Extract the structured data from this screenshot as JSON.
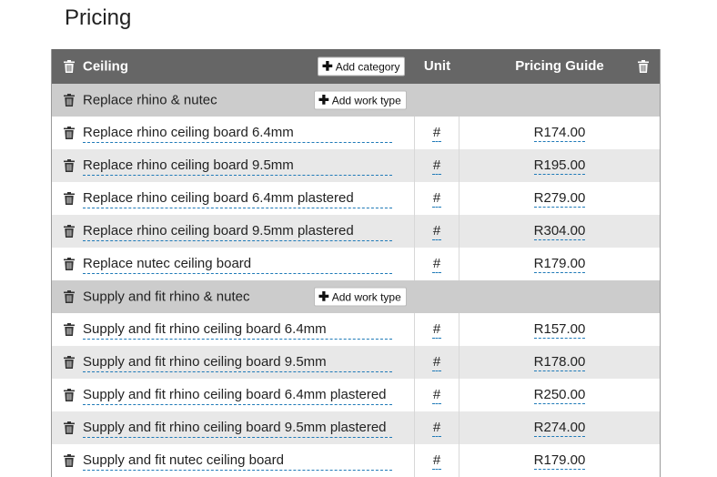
{
  "page": {
    "title": "Pricing"
  },
  "header": {
    "category": "Ceiling",
    "add_category_label": "Add category",
    "unit_label": "Unit",
    "pricing_guide_label": "Pricing Guide"
  },
  "groups": [
    {
      "name": "Replace rhino & nutec",
      "add_work_type_label": "Add work type",
      "items": [
        {
          "name": "Replace rhino ceiling board 6.4mm",
          "unit": "#",
          "price": "R174.00"
        },
        {
          "name": "Replace rhino ceiling board 9.5mm",
          "unit": "#",
          "price": "R195.00"
        },
        {
          "name": "Replace rhino ceiling board 6.4mm plastered",
          "unit": "#",
          "price": "R279.00"
        },
        {
          "name": "Replace rhino ceiling board 9.5mm plastered",
          "unit": "#",
          "price": "R304.00"
        },
        {
          "name": "Replace nutec ceiling board",
          "unit": "#",
          "price": "R179.00"
        }
      ]
    },
    {
      "name": "Supply and fit rhino & nutec",
      "add_work_type_label": "Add work type",
      "items": [
        {
          "name": "Supply and fit rhino ceiling board 6.4mm",
          "unit": "#",
          "price": "R157.00"
        },
        {
          "name": "Supply and fit rhino ceiling board 9.5mm",
          "unit": "#",
          "price": "R178.00"
        },
        {
          "name": "Supply and fit rhino ceiling board 6.4mm plastered",
          "unit": "#",
          "price": "R250.00"
        },
        {
          "name": "Supply and fit rhino ceiling board 9.5mm plastered",
          "unit": "#",
          "price": "R274.00"
        },
        {
          "name": "Supply and fit nutec ceiling board",
          "unit": "#",
          "price": "R179.00"
        }
      ]
    }
  ],
  "icons": {
    "delete": "trash-icon",
    "add": "plus-icon"
  },
  "colors": {
    "header_bg": "#666666",
    "group_bg": "#cccccc",
    "row_alt_bg": "#e8e8e8",
    "editable_underline": "#1f7ab8"
  }
}
